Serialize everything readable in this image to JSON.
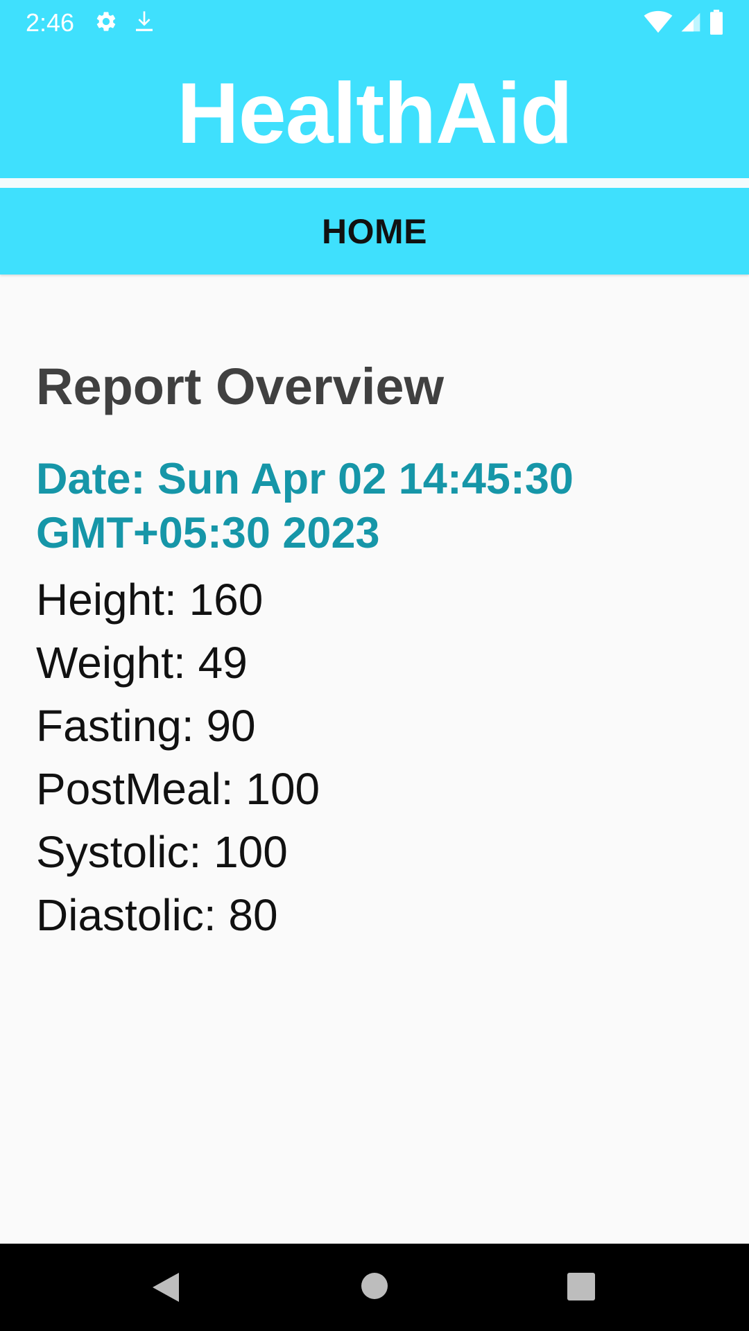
{
  "status_bar": {
    "time": "2:46",
    "left_icons": [
      "gear-icon",
      "download-icon"
    ],
    "right_icons": [
      "wifi-icon",
      "signal-icon",
      "battery-icon"
    ]
  },
  "app_bar": {
    "title": "HealthAid"
  },
  "tabs": [
    {
      "label": "HOME"
    }
  ],
  "report": {
    "heading": "Report Overview",
    "date": "Date: Sun Apr 02 14:45:30 GMT+05:30 2023",
    "lines": [
      "Height: 160",
      "Weight: 49",
      "Fasting: 90",
      "PostMeal: 100",
      "Systolic: 100",
      "Diastolic: 80"
    ]
  },
  "nav_bar": {
    "buttons": [
      "back-icon",
      "home-icon",
      "recents-icon"
    ]
  },
  "colors": {
    "accent": "#3fe0fd",
    "date_text": "#1696a8",
    "heading_text": "#404040",
    "background": "#fafafa"
  }
}
